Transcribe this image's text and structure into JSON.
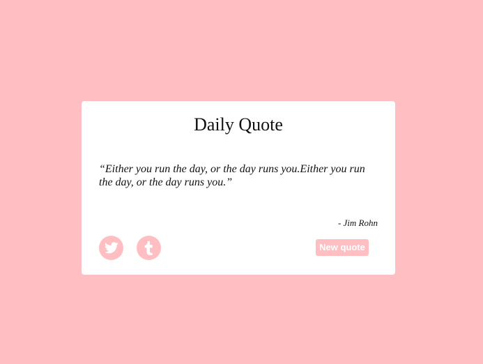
{
  "card": {
    "title": "Daily Quote",
    "quote": "“Either you run the day, or the day runs you.Either you run the day, or the day runs you.”",
    "author": "- Jim Rohn"
  },
  "actions": {
    "twitter_icon": "twitter-icon",
    "tumblr_icon": "tumblr-icon",
    "new_quote_label": "New quote"
  },
  "colors": {
    "background": "#ffbfc2",
    "card": "#ffffff",
    "text": "#111111",
    "button_text": "#ffffff"
  }
}
